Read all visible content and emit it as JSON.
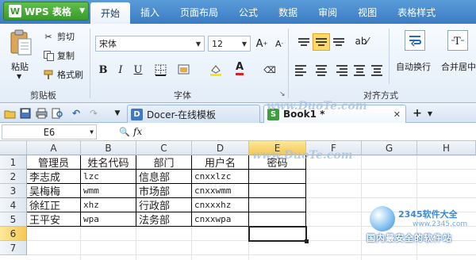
{
  "app": {
    "menu_button": "WPS 表格",
    "tabs": [
      "开始",
      "插入",
      "页面布局",
      "公式",
      "数据",
      "审阅",
      "视图",
      "表格样式"
    ],
    "active_tab": "开始"
  },
  "ribbon": {
    "clipboard": {
      "group_label": "剪贴板",
      "paste": "粘贴",
      "cut": "剪切",
      "copy": "复制",
      "format_painter": "格式刷"
    },
    "font": {
      "group_label": "字体",
      "font_name": "宋体",
      "font_size": "12",
      "bold": "B",
      "italic": "I",
      "underline": "U"
    },
    "alignment": {
      "group_label": "对齐方式",
      "wrap_text": "自动换行",
      "merge_center": "合并居中"
    }
  },
  "doc_tabs": [
    {
      "label": "Docer-在线模板",
      "icon": "D"
    },
    {
      "label": "Book1 *",
      "icon": "S"
    }
  ],
  "formula_bar": {
    "name_box": "E6",
    "fx": "fx"
  },
  "sheet": {
    "columns": [
      "A",
      "B",
      "C",
      "D",
      "E",
      "F",
      "G",
      "H"
    ],
    "rows": [
      "1",
      "2",
      "3",
      "4",
      "5",
      "6",
      "7"
    ],
    "selected_column": "E",
    "selected_row": "6",
    "cells": [
      [
        "管理员",
        "姓名代码",
        "部门",
        "用户名",
        "密码"
      ],
      [
        "李志成",
        "lzc",
        "信息部",
        "cnxxlzc",
        ""
      ],
      [
        "吴梅梅",
        "wmm",
        "市场部",
        "cnxxwmm",
        ""
      ],
      [
        "徐红正",
        "xhz",
        "行政部",
        "cnxxxhz",
        ""
      ],
      [
        "王平安",
        "wpa",
        "法务部",
        "cnxxwpa",
        ""
      ]
    ]
  },
  "watermarks": {
    "site": "www.DuoTe.com",
    "badge_name": "2345软件大全",
    "badge_url": "www.2345.com",
    "badge_slogan": "国内最安全的软件站"
  }
}
